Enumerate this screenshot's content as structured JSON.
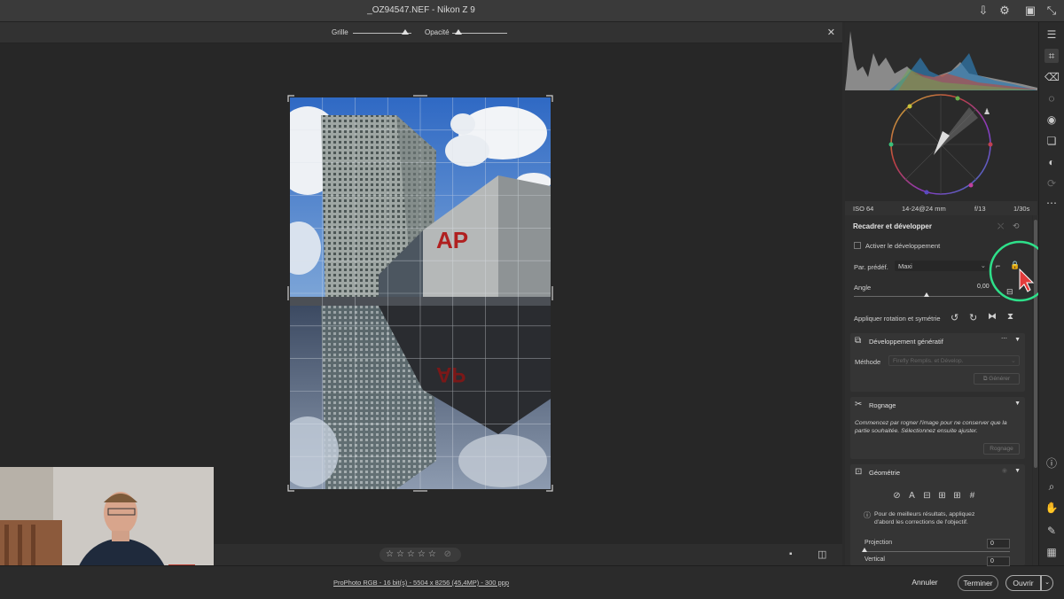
{
  "window": {
    "title": "_OZ94547.NEF  -  Nikon Z 9"
  },
  "overlay_toolbar": {
    "grid_label": "Grille",
    "opacity_label": "Opacité",
    "grid_level": 0.9,
    "opacity_level": 0.12
  },
  "exif": {
    "iso": "ISO 64",
    "lens": "14-24@24 mm",
    "aperture": "f/13",
    "shutter": "1/30s"
  },
  "crop_panel": {
    "title": "Recadrer et développer",
    "enable_develop_label": "Activer le développement",
    "preset_label": "Par. prédéf.",
    "preset_value": "Maxi",
    "angle_label": "Angle",
    "angle_value": "0,00",
    "angle_level": 0.5,
    "rotate_label": "Appliquer rotation et symétrie"
  },
  "generative": {
    "title": "Développement génératif",
    "method_label": "Méthode",
    "method_value": "Firefly Remplis. et Dévelop.",
    "generate_label": "Générer"
  },
  "crop_section": {
    "title": "Rognage",
    "hint": "Commencez par rogner l'image pour ne conserver que la partie souhaitée. Sélectionnez ensuite ajuster.",
    "hint_line1": "Commencez par rogner l'image pour ne conserver que la",
    "hint_line2": "partie souhaitée. Sélectionnez ensuite ajuster.",
    "button_label": "Rognage"
  },
  "geometry": {
    "title": "Géométrie",
    "info_line1": "Pour de meilleurs résultats, appliquez",
    "info_line2": "d'abord les corrections de l'objectif.",
    "projection_label": "Projection",
    "projection_value": "0",
    "vertical_label": "Vertical",
    "vertical_value": "0"
  },
  "footer": {
    "file_info": "ProPhoto RGB - 16 bit(s) - 5504 x 8256 (45,4MP) - 300 ppp",
    "cancel_label": "Annuler",
    "done_label": "Terminer",
    "open_label": "Ouvrir"
  },
  "rating": {
    "stars": "☆☆☆☆☆",
    "value": 0
  },
  "colors": {
    "accent_ring": "#2ee08a",
    "cursor": "#e23b3b",
    "panel_bg": "#2e2e2e"
  },
  "icons": {
    "titlebar": [
      "export-icon",
      "gear-icon",
      "present-icon",
      "collapse-icon"
    ],
    "rail": [
      "edit-sliders-icon",
      "crop-icon",
      "eraser-icon",
      "mask-icon",
      "redeye-icon",
      "presets-icon",
      "snapshot-icon",
      "reset-icon",
      "more-icon",
      "info-icon",
      "zoom-icon",
      "hand-icon",
      "eyedropper-icon",
      "grid-icon"
    ]
  }
}
